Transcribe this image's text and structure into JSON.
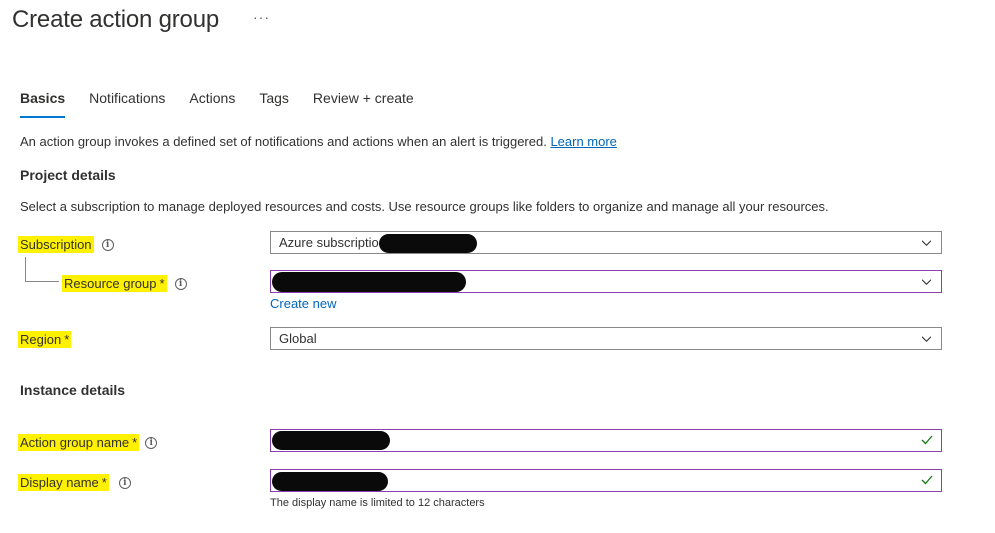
{
  "header": {
    "title": "Create action group",
    "more": "···"
  },
  "tabs": [
    {
      "label": "Basics",
      "active": true
    },
    {
      "label": "Notifications",
      "active": false
    },
    {
      "label": "Actions",
      "active": false
    },
    {
      "label": "Tags",
      "active": false
    },
    {
      "label": "Review + create",
      "active": false
    }
  ],
  "intro": {
    "text": "An action group invokes a defined set of notifications and actions when an alert is triggered. ",
    "link": "Learn more"
  },
  "project": {
    "heading": "Project details",
    "description": "Select a subscription to manage deployed resources and costs. Use resource groups like folders to organize and manage all your resources.",
    "subscription": {
      "label": "Subscription",
      "value": "Azure subscription"
    },
    "resource_group": {
      "label": "Resource group",
      "required": "*",
      "value": "",
      "create_new": "Create new"
    },
    "region": {
      "label": "Region",
      "required": "*",
      "value": "Global"
    }
  },
  "instance": {
    "heading": "Instance details",
    "action_group_name": {
      "label": "Action group name",
      "required": "*",
      "value": ""
    },
    "display_name": {
      "label": "Display name",
      "required": "*",
      "value": "",
      "hint": "The display name is limited to 12 characters"
    }
  },
  "colors": {
    "accent": "#0078d4",
    "link": "#0067b8",
    "highlight": "#fff100",
    "valid_border": "#8a3eb0",
    "check": "#107c10"
  }
}
